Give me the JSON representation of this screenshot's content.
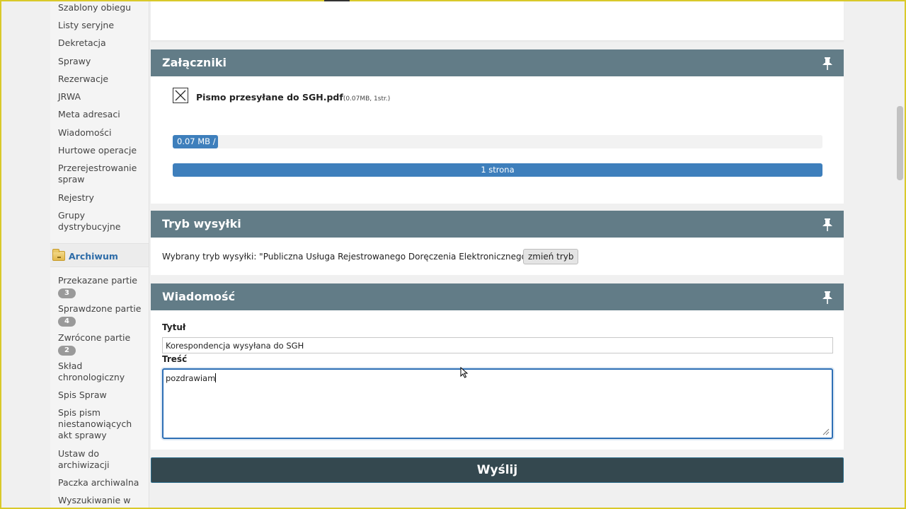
{
  "sidebar": {
    "items": [
      {
        "label": "Szablony obiegu"
      },
      {
        "label": "Listy seryjne"
      },
      {
        "label": "Dekretacja"
      },
      {
        "label": "Sprawy"
      },
      {
        "label": "Rezerwacje"
      },
      {
        "label": "JRWA"
      },
      {
        "label": "Meta adresaci"
      },
      {
        "label": "Wiadomości"
      },
      {
        "label": "Hurtowe operacje"
      },
      {
        "label": "Przerejestrowanie spraw"
      },
      {
        "label": "Rejestry"
      },
      {
        "label": "Grupy dystrybucyjne"
      }
    ],
    "section": {
      "label": "Archiwum",
      "icon": "folder-icon"
    },
    "archive_items": [
      {
        "label": "Przekazane partie",
        "badge": "3"
      },
      {
        "label": "Sprawdzone partie",
        "badge": "4"
      },
      {
        "label": "Zwrócone partie",
        "badge": "2"
      },
      {
        "label": "Skład chronologiczny"
      },
      {
        "label": "Spis Spraw"
      },
      {
        "label": "Spis pism niestanowiących akt sprawy"
      },
      {
        "label": "Ustaw do archiwizacji"
      },
      {
        "label": "Paczka archiwalna"
      },
      {
        "label": "Wyszukiwanie w"
      }
    ]
  },
  "attachments": {
    "title": "Załączniki",
    "file_name": "Pismo przesyłane do SGH.pdf",
    "file_meta": "(0.07MB, 1str.)",
    "size_label": "0.07 MB /",
    "size_progress_pct": 7,
    "pages_label": "1 strona"
  },
  "send_mode": {
    "title": "Tryb wysyłki",
    "text": "Wybrany tryb wysyłki: \"Publiczna Usługa Rejestrowanego Doręczenia Elektronicznego (PURDE)\"",
    "change_button": "zmień tryb"
  },
  "message": {
    "title": "Wiadomość",
    "subject_label": "Tytuł",
    "subject_value": "Korespondencja wysyłana do SGH",
    "body_label": "Treść",
    "body_value": "pozdrawiam"
  },
  "send_button": "Wyślij",
  "colors": {
    "panel_header": "#627c87",
    "accent_blue": "#3e7fbc",
    "send_button": "#34484f",
    "link_blue": "#2d6ca8"
  }
}
